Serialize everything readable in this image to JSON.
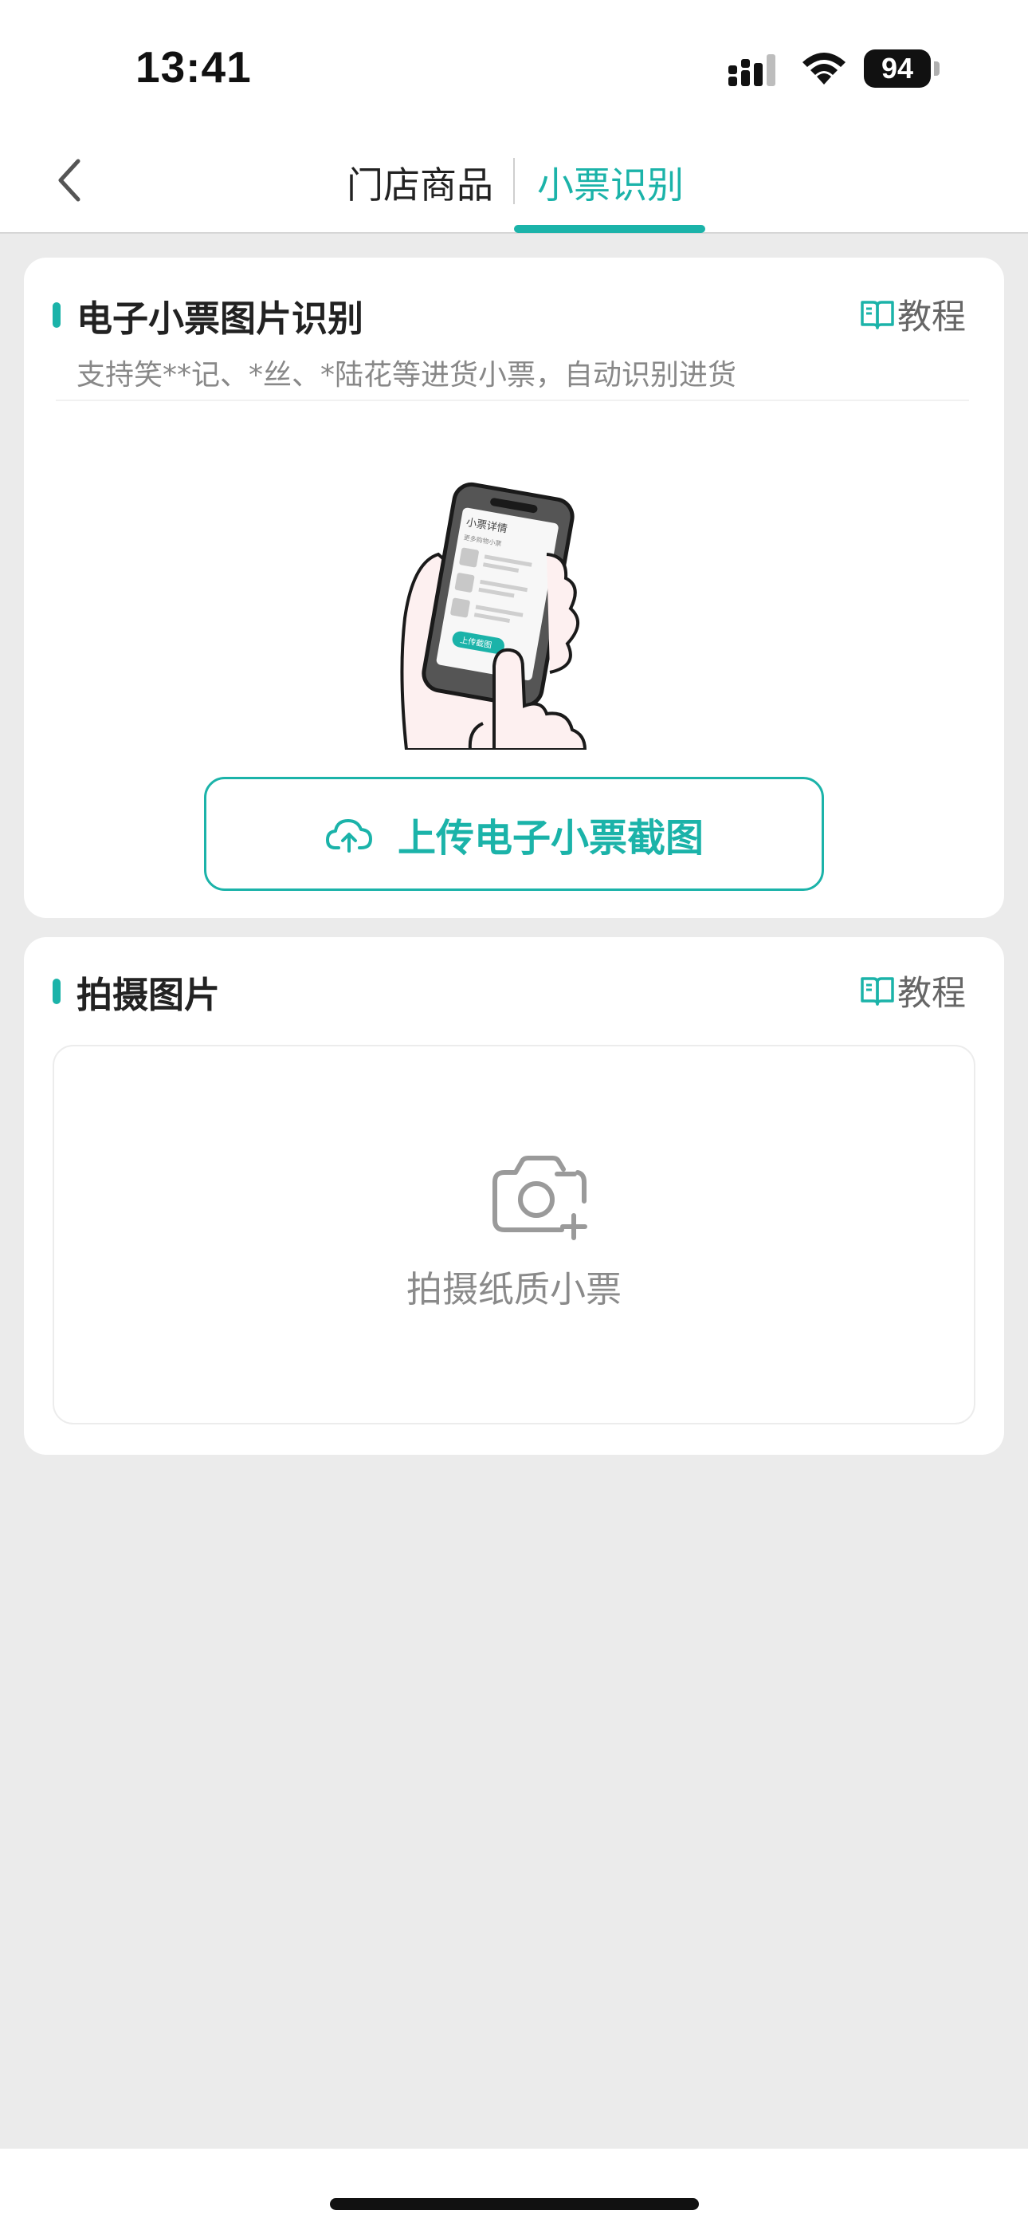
{
  "status_bar": {
    "time": "13:41",
    "battery": "94"
  },
  "nav": {
    "tabs": [
      {
        "label": "门店商品",
        "active": false
      },
      {
        "label": "小票识别",
        "active": true
      }
    ],
    "back_icon": "chevron-left-icon",
    "accent_color": "#1bb3a9"
  },
  "electronic_receipt": {
    "title": "电子小票图片识别",
    "subtitle": "支持笑**记、*丝、*陆花等进货小票，自动识别进货",
    "tutorial_label": "教程",
    "illustration": {
      "screen_title": "小票详情",
      "screen_subtitle": "更多购物小票",
      "screen_button": "上传截图"
    },
    "upload_button_label": "上传电子小票截图"
  },
  "photo_capture": {
    "title": "拍摄图片",
    "tutorial_label": "教程",
    "capture_label": "拍摄纸质小票"
  }
}
